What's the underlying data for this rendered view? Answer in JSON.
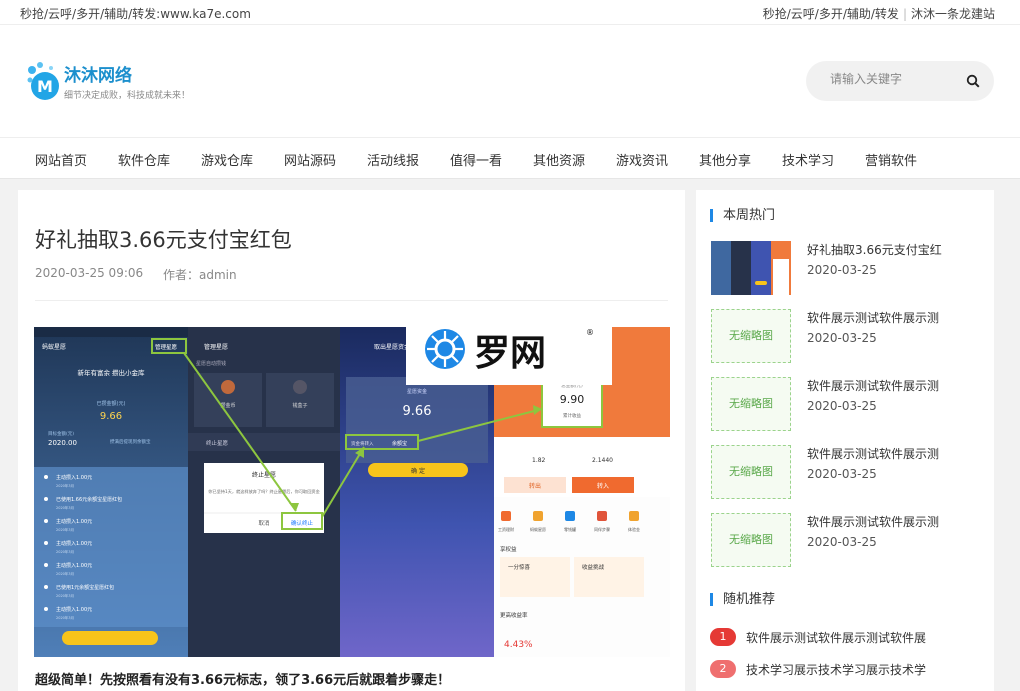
{
  "topbar": {
    "left_text": "秒抢/云呼/多开/辅助/转发:www.ka7e.com",
    "right_links": [
      "秒抢/云呼/多开/辅助/转发",
      "沐沐一条龙建站"
    ]
  },
  "brand": {
    "name": "沐沐网络",
    "slogan": "细节决定成败，科技成就未来！",
    "logo_letter": "M"
  },
  "search": {
    "placeholder": "请输入关键字"
  },
  "nav": [
    "网站首页",
    "软件仓库",
    "游戏仓库",
    "网站源码",
    "活动线报",
    "值得一看",
    "其他资源",
    "游戏资讯",
    "其他分享",
    "技术学习",
    "营销软件"
  ],
  "post": {
    "title": "好礼抽取3.66元支付宝红包",
    "date": "2020-03-25 09:06",
    "author_label": "作者：",
    "author": "admin",
    "lead": "超级简单！先按照看有没有3.66元标志，领了3.66元后就跟着步骤走！"
  },
  "screenshot": {
    "watermark_text": "罗网",
    "p1": {
      "back_label": "蚂蚁星愿",
      "tag": "管理星愿",
      "subtitle": "新年有富余 攒出小金库",
      "amount_label": "已攒金额(元)",
      "amount": "9.66",
      "goal_label": "目标金额(元)",
      "goal": "2020.00",
      "goal_note": "攒满后提现到余额宝",
      "items": [
        "主动攒入1.00元",
        "已使用1.66元余额宝星愿红包",
        "主动攒入1.00元",
        "主动攒入1.00元",
        "主动攒入1.00元",
        "已使用1元余额宝星愿红包",
        "主动攒入1.00元"
      ],
      "item_date": "2020年3月"
    },
    "p2": {
      "header": "管理星愿",
      "row1": "星愿自动攒钱",
      "opt1": "攒金币",
      "opt2": "钱盒子",
      "row2": "终止星愿",
      "dialog_title": "终止星愿",
      "dialog_body": "你已坚持1天，就这样放弃了吗？终止星愿后，你可取回资金",
      "cancel": "取消",
      "confirm": "确认终止"
    },
    "p3": {
      "header": "取出星愿资金",
      "label": "星愿资金",
      "amount": "9.66",
      "dest_label": "资金将转入",
      "dest": "余额宝",
      "confirm": "确 定"
    },
    "p4": {
      "amount_label": "总金额(元)",
      "amount": "9.90",
      "sub": "累计收益",
      "v1": "1.82",
      "v2": "2.1440",
      "btn_out": "转出",
      "btn_in": "转入",
      "icons": [
        "工资理财",
        "蚂蚁星愿",
        "零钱罐",
        "同伴步骤",
        "体验金"
      ],
      "benefit": "享权益",
      "card1": "一分惊喜",
      "card2": "收益挑战",
      "rate_label": "更高收益率",
      "rate": "4.43%"
    }
  },
  "sidebar": {
    "hot_title": "本周热门",
    "no_thumb_text": "无缩略图",
    "hot_items": [
      {
        "title": "好礼抽取3.66元支付宝红",
        "date": "2020-03-25"
      },
      {
        "title": "软件展示测试软件展示测",
        "date": "2020-03-25"
      },
      {
        "title": "软件展示测试软件展示测",
        "date": "2020-03-25"
      },
      {
        "title": "软件展示测试软件展示测",
        "date": "2020-03-25"
      },
      {
        "title": "软件展示测试软件展示测",
        "date": "2020-03-25"
      }
    ],
    "random_title": "随机推荐",
    "random_items": [
      {
        "num": "1",
        "title": "软件展示测试软件展示测试软件展"
      },
      {
        "num": "2",
        "title": "技术学习展示技术学习展示技术学"
      }
    ]
  },
  "colors": {
    "accent": "#1e88e5",
    "rank1": "#e53935",
    "rank2": "#ef6f6f",
    "highlight": "#8dc63f"
  }
}
